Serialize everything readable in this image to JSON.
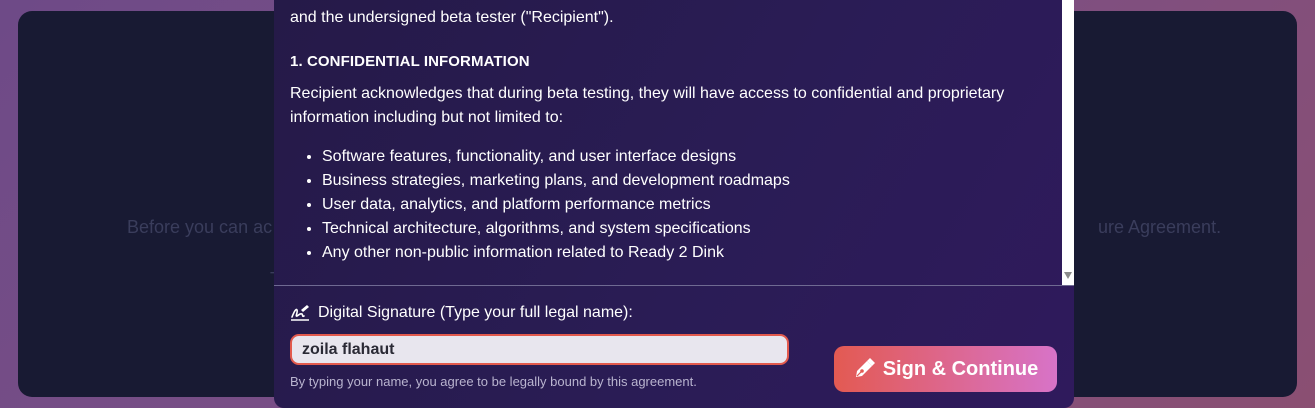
{
  "background": {
    "line1_left": "Before you can ac",
    "line1_right": "ure Agreement.",
    "line2": "Th"
  },
  "agreement": {
    "intro_line": "and the undersigned beta tester (\"Recipient\").",
    "section_title": "1. CONFIDENTIAL INFORMATION",
    "paragraph": "Recipient acknowledges that during beta testing, they will have access to confidential and proprietary information including but not limited to:",
    "bullets": [
      "Software features, functionality, and user interface designs",
      "Business strategies, marketing plans, and development roadmaps",
      "User data, analytics, and platform performance metrics",
      "Technical architecture, algorithms, and system specifications",
      "Any other non-public information related to Ready 2 Dink"
    ]
  },
  "signature": {
    "label": "Digital Signature (Type your full legal name):",
    "value": "zoila flahaut",
    "note": "By typing your name, you agree to be legally bound by this agreement.",
    "icon": "signature-icon"
  },
  "button": {
    "label": "Sign & Continue",
    "icon": "pen-icon"
  },
  "colors": {
    "accent_start": "#e35a52",
    "accent_end": "#d773c8",
    "input_border": "#e25a4d"
  }
}
